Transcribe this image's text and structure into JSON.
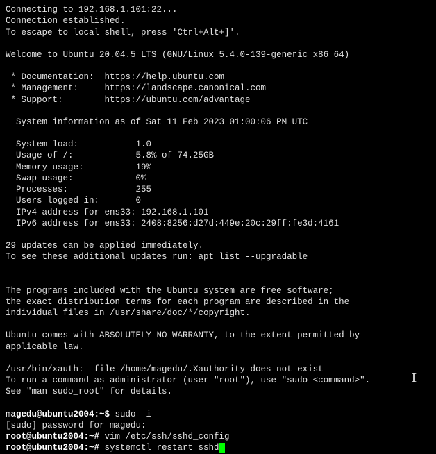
{
  "conn": {
    "connecting": "Connecting to 192.168.1.101:22...",
    "established": "Connection established.",
    "escape": "To escape to local shell, press 'Ctrl+Alt+]'."
  },
  "welcome": "Welcome to Ubuntu 20.04.5 LTS (GNU/Linux 5.4.0-139-generic x86_64)",
  "links": {
    "doc": " * Documentation:  https://help.ubuntu.com",
    "mgmt": " * Management:     https://landscape.canonical.com",
    "support": " * Support:        https://ubuntu.com/advantage"
  },
  "sysinfo_header": "  System information as of Sat 11 Feb 2023 01:00:06 PM UTC",
  "sysinfo": {
    "load": "  System load:           1.0",
    "usage": "  Usage of /:            5.8% of 74.25GB",
    "mem": "  Memory usage:          19%",
    "swap": "  Swap usage:            0%",
    "procs": "  Processes:             255",
    "users": "  Users logged in:       0",
    "ipv4": "  IPv4 address for ens33: 192.168.1.101",
    "ipv6": "  IPv6 address for ens33: 2408:8256:d27d:449e:20c:29ff:fe3d:4161"
  },
  "updates": {
    "line1": "29 updates can be applied immediately.",
    "line2": "To see these additional updates run: apt list --upgradable"
  },
  "legal": {
    "l1": "The programs included with the Ubuntu system are free software;",
    "l2": "the exact distribution terms for each program are described in the",
    "l3": "individual files in /usr/share/doc/*/copyright.",
    "l4": "Ubuntu comes with ABSOLUTELY NO WARRANTY, to the extent permitted by",
    "l5": "applicable law."
  },
  "xauth": "/usr/bin/xauth:  file /home/magedu/.Xauthority does not exist",
  "sudo_hint1": "To run a command as administrator (user \"root\"), use \"sudo <command>\".",
  "sudo_hint2": "See \"man sudo_root\" for details.",
  "prompts": {
    "p1_prefix": "magedu@ubuntu2004:~$ ",
    "p1_cmd": "sudo -i",
    "p2": "[sudo] password for magedu:",
    "p3_prefix": "root@ubuntu2004:~# ",
    "p3_cmd": "vim /etc/ssh/sshd_config",
    "p4_prefix": "root@ubuntu2004:~# ",
    "p4_cmd": "systemctl restart sshd"
  }
}
